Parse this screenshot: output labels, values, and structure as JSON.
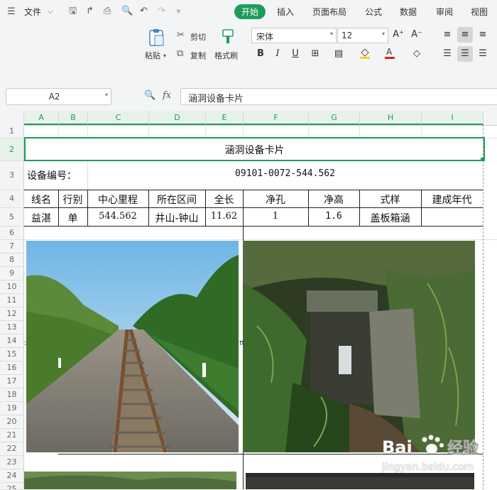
{
  "menu": {
    "file_label": "文件",
    "tabs": [
      "开始",
      "插入",
      "页面布局",
      "公式",
      "数据",
      "审阅",
      "视图"
    ]
  },
  "ribbon": {
    "paste_label": "粘贴",
    "cut_label": "剪切",
    "copy_label": "复制",
    "format_painter_label": "格式刷",
    "font_name": "宋体",
    "font_size": "12",
    "bold": "B",
    "italic": "I",
    "underline": "U"
  },
  "formula_bar": {
    "name_box": "A2",
    "fx_label": "fx",
    "content": "涵洞设备卡片"
  },
  "columns": [
    "A",
    "B",
    "C",
    "D",
    "E",
    "F",
    "G",
    "H",
    "I"
  ],
  "rows": [
    "1",
    "2",
    "3",
    "4",
    "5",
    "6",
    "7",
    "8",
    "9",
    "10",
    "11",
    "12",
    "13",
    "14",
    "15",
    "16",
    "17",
    "18",
    "19",
    "20",
    "21",
    "22",
    "23",
    "24",
    "25"
  ],
  "sheet": {
    "title": "涵洞设备卡片",
    "equip_no_label": "设备编号：",
    "equip_no_value": "09101-0072-544.562",
    "headers": [
      "线名",
      "行别",
      "中心里程",
      "所在区间",
      "全长",
      "净孔",
      "净高",
      "式样",
      "建成年代"
    ],
    "row5": [
      "益湛",
      "单",
      "544.562",
      "井山-钟山",
      "11.62",
      "1",
      "1.6",
      "盖板箱涵",
      ""
    ]
  },
  "watermark": {
    "brand": "Bai",
    "brand2": "经验",
    "url": "jingyan.baidu.com"
  },
  "colors": {
    "accent": "#1d9d5a",
    "ribbon_bg": "#f3f4f6"
  }
}
